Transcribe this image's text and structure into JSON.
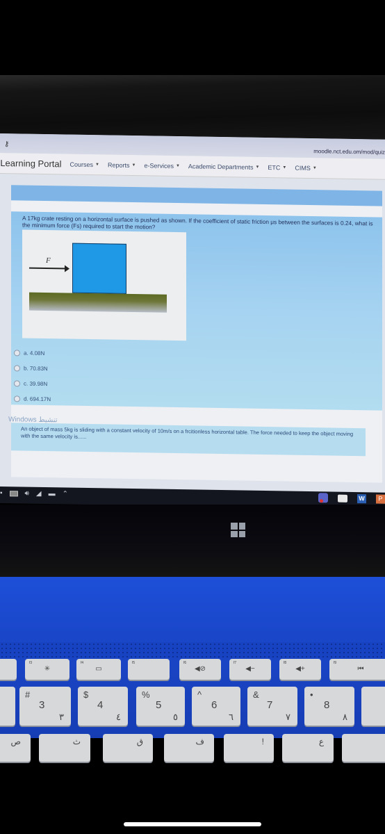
{
  "browser": {
    "url": "moodle.nct.edu.om/mod/quiz"
  },
  "navbar": {
    "brand": "-Learning Portal",
    "items": [
      {
        "label": "Courses"
      },
      {
        "label": "Reports"
      },
      {
        "label": "e-Services"
      },
      {
        "label": "Academic Departments"
      },
      {
        "label": "ETC"
      },
      {
        "label": "CIMS"
      }
    ]
  },
  "question1": {
    "text": "A 17kg crate resting on a horizontal surface is pushed as shown. If the coefficient of static friction μs between the surfaces is 0.24, what is the minimum force (Fs) required to start the motion?",
    "figure": {
      "force_label": "F"
    },
    "options": [
      {
        "label": "a. 4.08N"
      },
      {
        "label": "b. 70.83N"
      },
      {
        "label": "c. 39.98N"
      },
      {
        "label": "d. 694.17N"
      }
    ]
  },
  "question2": {
    "watermark": "Windows تنشيط",
    "text": "An object of mass 5kg is sliding with a constant velocity of 10m/s on a frcitionless horizontal table. The force needed to keep the object moving with the same velocity is......"
  },
  "taskbar": {
    "word_letter": "W",
    "ppt_letter": "P"
  },
  "keyboard": {
    "fkeys": [
      {
        "num": "f3",
        "sym": "✳"
      },
      {
        "num": "f4",
        "sym": "▭"
      },
      {
        "num": "f5",
        "sym": ""
      },
      {
        "num": "f6",
        "sym": "◀⊘"
      },
      {
        "num": "f7",
        "sym": "◀−"
      },
      {
        "num": "f8",
        "sym": "◀+"
      },
      {
        "num": "f9",
        "sym": "⏮"
      }
    ],
    "numkeys": [
      {
        "sym": "#",
        "digit": "3",
        "arabic": "٣"
      },
      {
        "sym": "$",
        "digit": "4",
        "arabic": "٤"
      },
      {
        "sym": "%",
        "digit": "5",
        "arabic": "٥"
      },
      {
        "sym": "^",
        "digit": "6",
        "arabic": "٦"
      },
      {
        "sym": "&",
        "digit": "7",
        "arabic": "٧"
      },
      {
        "sym": "•",
        "digit": "8",
        "arabic": "٨"
      }
    ],
    "rowkeys": [
      {
        "sym": "ص"
      },
      {
        "sym": "ث"
      },
      {
        "sym": "ق"
      },
      {
        "sym": "ف"
      },
      {
        "sym": "!"
      },
      {
        "sym": "ع"
      }
    ]
  }
}
